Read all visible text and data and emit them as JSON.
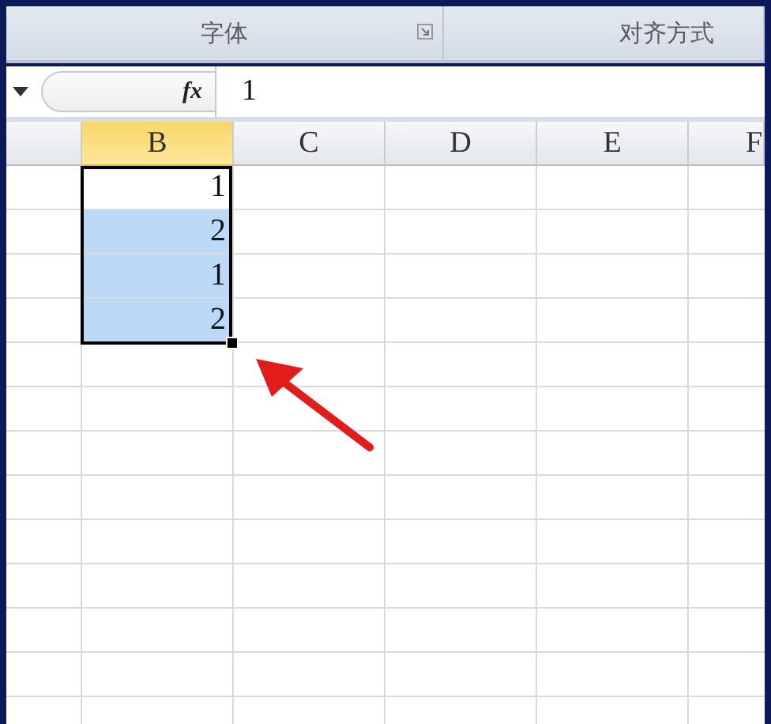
{
  "ribbon": {
    "groups": [
      {
        "label": "字体",
        "has_launcher": true
      },
      {
        "label": "对齐方式",
        "has_launcher": false
      }
    ]
  },
  "formula_bar": {
    "function_label": "fx",
    "value": "1"
  },
  "sheet": {
    "columns": [
      {
        "label": "B",
        "selected": true
      },
      {
        "label": "C",
        "selected": false
      },
      {
        "label": "D",
        "selected": false
      },
      {
        "label": "E",
        "selected": false
      },
      {
        "label": "F",
        "selected": false
      }
    ],
    "column_b_cells": [
      {
        "value": "1",
        "highlighted": false
      },
      {
        "value": "2",
        "highlighted": true
      },
      {
        "value": "1",
        "highlighted": true
      },
      {
        "value": "2",
        "highlighted": true
      }
    ]
  }
}
